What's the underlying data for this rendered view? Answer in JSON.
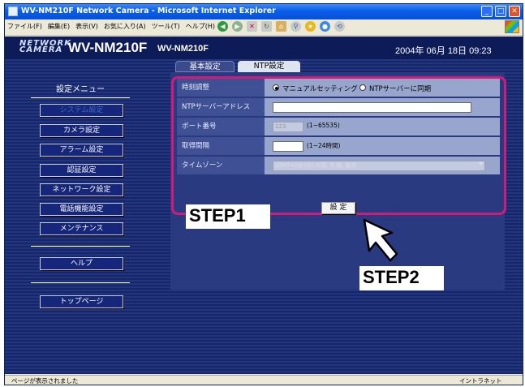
{
  "window": {
    "title": "WV-NM210F Network Camera - Microsoft Internet Explorer"
  },
  "menubar": {
    "items": [
      "ファイル(F)",
      "編集(E)",
      "表示(V)",
      "お気に入り(A)",
      "ツール(T)",
      "ヘルプ(H)"
    ]
  },
  "header": {
    "logo": {
      "line1": "NETWORK",
      "line2": "CAMERA"
    },
    "model": "WV-NM210F",
    "model_sub": "WV-NM210F",
    "datetime": "2004年 06月 18日 09:23"
  },
  "sidebar": {
    "title": "設定メニュー",
    "items": [
      {
        "label": "システム設定",
        "active": true
      },
      {
        "label": "カメラ設定"
      },
      {
        "label": "アラーム設定"
      },
      {
        "label": "認証設定"
      },
      {
        "label": "ネットワーク設定"
      },
      {
        "label": "電話機能設定"
      },
      {
        "label": "メンテナンス"
      }
    ],
    "help": "ヘルプ",
    "top": "トップページ"
  },
  "tabs": [
    {
      "label": "基本設定"
    },
    {
      "label": "NTP設定",
      "active": true
    }
  ],
  "form": {
    "rows": [
      {
        "label": "時刻調整"
      },
      {
        "label": "NTPサーバーアドレス"
      },
      {
        "label": "ポート番号"
      },
      {
        "label": "取得間隔"
      },
      {
        "label": "タイムゾーン"
      }
    ],
    "time_adjust": {
      "option1": "マニュアルセッティング",
      "option2": "NTPサーバーに同期",
      "selected": "manual"
    },
    "ntp_address": {
      "value": ""
    },
    "port": {
      "value": "123",
      "hint": "(1~65535)"
    },
    "interval": {
      "value": "",
      "hint": "(1~24時間)"
    },
    "timezone": {
      "value": "(GMT+09:00) 大阪, 札幌, 東京"
    },
    "submit": "設 定"
  },
  "annotations": {
    "step1": "STEP1",
    "step2": "STEP2"
  },
  "statusbar": {
    "text": "ページが表示されました",
    "zone": "イントラネット"
  },
  "colors": {
    "highlight": "#d21a7a",
    "header": "#0d1b58",
    "panel": "#2a3a80"
  }
}
